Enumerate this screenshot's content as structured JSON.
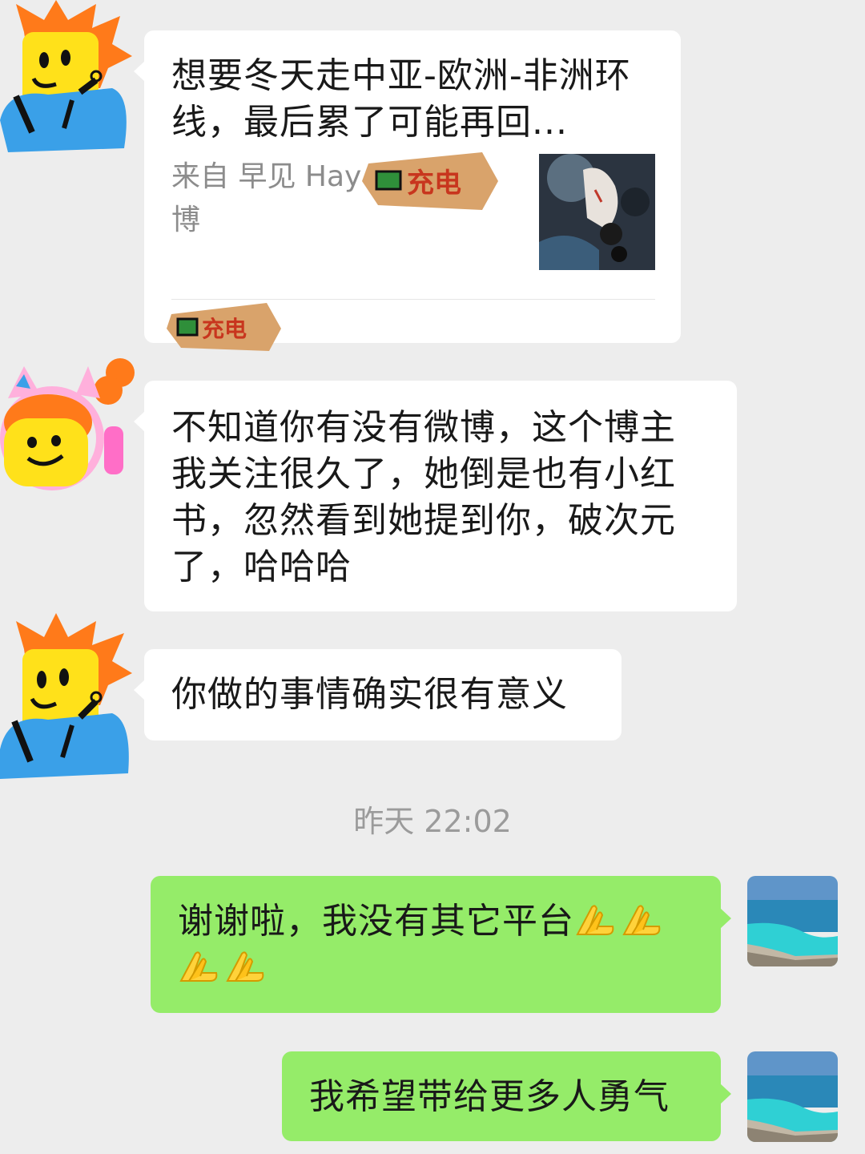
{
  "colors": {
    "background": "#ededed",
    "incoming_bubble": "#ffffff",
    "outgoing_bubble": "#95ec69",
    "timestamp_text": "#9b9b9b",
    "card_source_text": "#8c8c8c"
  },
  "messages": [
    {
      "sender": "contact-orange-hair",
      "type": "link-card",
      "card": {
        "title": "想要冬天走中亚-欧洲-非洲环线，最后累了可能再回...",
        "source": "来自 早见 Hay",
        "source_tail": "博",
        "thumbnail_icon": "artwork-thumbnail",
        "sticker_label": "充电",
        "sticker_icon": "charging-sticker"
      }
    },
    {
      "sender": "contact-cat-ears",
      "type": "text",
      "text": "不知道你有没有微博，这个博主我关注很久了，她倒是也有小红书，忽然看到她提到你，破次元了，哈哈哈"
    },
    {
      "sender": "contact-orange-hair",
      "type": "text",
      "text": "你做的事情确实很有意义"
    }
  ],
  "timestamp": "昨天 22:02",
  "replies": [
    {
      "sender": "me",
      "type": "text",
      "text": "谢谢啦，我没有其它平台",
      "emoji_count": 4,
      "emoji_icon": "praying-hands-emoji"
    },
    {
      "sender": "me",
      "type": "text",
      "text": "我希望带给更多人勇气"
    }
  ]
}
